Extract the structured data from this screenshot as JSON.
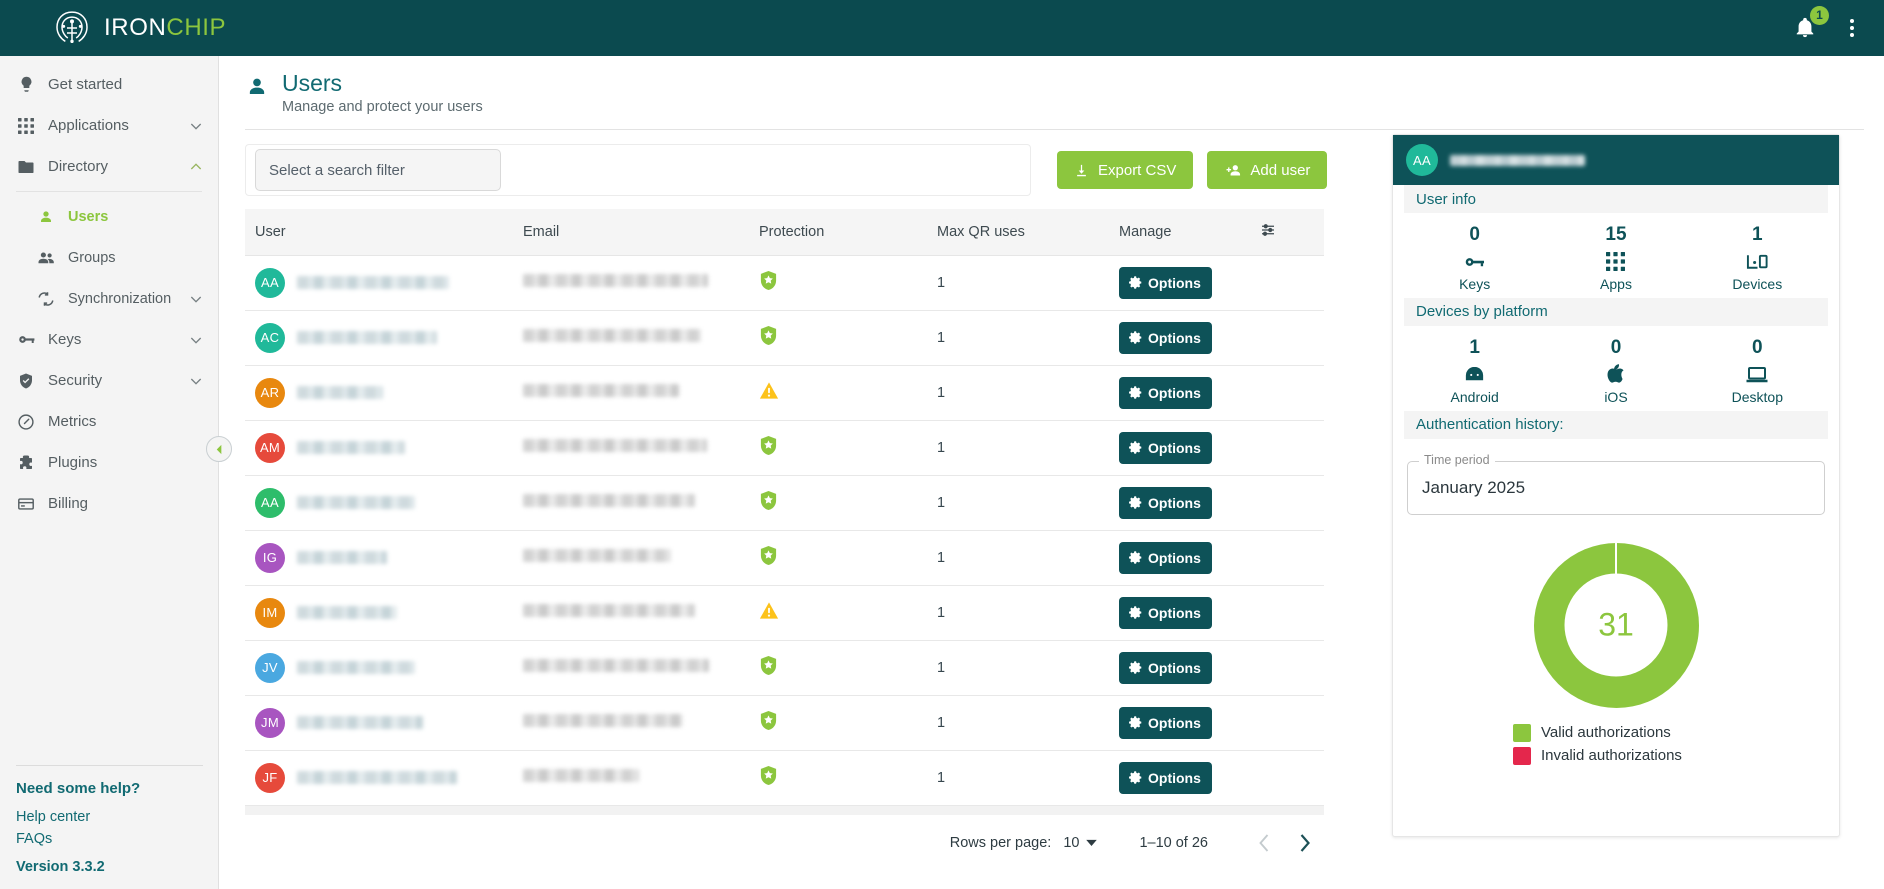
{
  "brand": {
    "name_first": "IRON",
    "name_second": "CHIP"
  },
  "topbar": {
    "notification_count": "1",
    "accent_green": "#8cc63e",
    "bg": "#0b4a4f"
  },
  "sidebar": {
    "items": [
      {
        "label": "Get started",
        "icon": "lightbulb-icon",
        "expandable": false,
        "active": false
      },
      {
        "label": "Applications",
        "icon": "grid-icon",
        "expandable": true,
        "active": false
      },
      {
        "label": "Directory",
        "icon": "folder-icon",
        "expandable": true,
        "active": false
      }
    ],
    "directory_children": [
      {
        "label": "Users",
        "icon": "person-icon",
        "active": true
      },
      {
        "label": "Groups",
        "icon": "people-icon",
        "active": false
      },
      {
        "label": "Synchronization",
        "icon": "sync-icon",
        "active": false,
        "expandable": true
      }
    ],
    "items_bottom": [
      {
        "label": "Keys",
        "icon": "key-icon",
        "expandable": true
      },
      {
        "label": "Security",
        "icon": "shield-check-icon",
        "expandable": true
      },
      {
        "label": "Metrics",
        "icon": "gauge-icon",
        "expandable": false
      },
      {
        "label": "Plugins",
        "icon": "puzzle-icon",
        "expandable": false
      },
      {
        "label": "Billing",
        "icon": "credit-card-icon",
        "expandable": false
      }
    ],
    "help": {
      "title": "Need some help?",
      "links": [
        "Help center",
        "FAQs"
      ],
      "version": "Version 3.3.2"
    }
  },
  "page": {
    "title": "Users",
    "subtitle": "Manage and protect your users"
  },
  "toolbar": {
    "filter_placeholder": "Select a search filter",
    "export_label": "Export CSV",
    "add_user_label": "Add user"
  },
  "table": {
    "columns": [
      "User",
      "Email",
      "Protection",
      "Max QR uses",
      "Manage"
    ],
    "settings_icon": "tune-icon",
    "options_label": "Options",
    "rows": [
      {
        "initials": "AA",
        "color": "#20b99a",
        "name_w": 152,
        "email_w": 185,
        "protection": "shield-star",
        "max_qr": "1"
      },
      {
        "initials": "AC",
        "color": "#20b99a",
        "name_w": 140,
        "email_w": 178,
        "protection": "shield-star",
        "max_qr": "1"
      },
      {
        "initials": "AR",
        "color": "#e8880f",
        "name_w": 86,
        "email_w": 156,
        "protection": "warning",
        "max_qr": "1"
      },
      {
        "initials": "AM",
        "color": "#e64a3b",
        "name_w": 108,
        "email_w": 184,
        "protection": "shield-star",
        "max_qr": "1"
      },
      {
        "initials": "AA",
        "color": "#2ebd6b",
        "name_w": 118,
        "email_w": 172,
        "protection": "shield-star",
        "max_qr": "1"
      },
      {
        "initials": "IG",
        "color": "#a855c0",
        "name_w": 90,
        "email_w": 148,
        "protection": "shield-star",
        "max_qr": "1"
      },
      {
        "initials": "IM",
        "color": "#e8880f",
        "name_w": 100,
        "email_w": 172,
        "protection": "warning",
        "max_qr": "1"
      },
      {
        "initials": "JV",
        "color": "#4aa8e0",
        "name_w": 118,
        "email_w": 186,
        "protection": "shield-star",
        "max_qr": "1"
      },
      {
        "initials": "JM",
        "color": "#a855c0",
        "name_w": 126,
        "email_w": 160,
        "protection": "shield-star",
        "max_qr": "1"
      },
      {
        "initials": "JF",
        "color": "#e64a3b",
        "name_w": 160,
        "email_w": 116,
        "protection": "shield-star",
        "max_qr": "1"
      }
    ]
  },
  "pagination": {
    "rows_per_page_label": "Rows per page:",
    "rows_per_page_value": "10",
    "range": "1–10 of 26",
    "prev_enabled": false,
    "next_enabled": true
  },
  "detail_panel": {
    "avatar_initials": "AA",
    "avatar_color": "#20b99a",
    "user_info_heading": "User info",
    "user_info": [
      {
        "value": "0",
        "label": "Keys",
        "icon": "key-icon"
      },
      {
        "value": "15",
        "label": "Apps",
        "icon": "grid-icon"
      },
      {
        "value": "1",
        "label": "Devices",
        "icon": "devices-icon"
      }
    ],
    "devices_heading": "Devices by platform",
    "devices": [
      {
        "value": "1",
        "label": "Android",
        "icon": "android-icon"
      },
      {
        "value": "0",
        "label": "iOS",
        "icon": "apple-icon"
      },
      {
        "value": "0",
        "label": "Desktop",
        "icon": "laptop-icon"
      }
    ],
    "auth_heading": "Authentication history:",
    "time_period_label": "Time period",
    "time_period_value": "January 2025"
  },
  "chart_data": {
    "type": "pie",
    "title": "Authentication history",
    "subtitle": "January 2025",
    "center_label": "31",
    "categories": [
      "Valid authorizations",
      "Invalid authorizations"
    ],
    "values": [
      31,
      0
    ],
    "colors": [
      "#8cc63e",
      "#e4274c"
    ],
    "legend_position": "bottom",
    "donut": true,
    "inner_radius_ratio": 0.62
  }
}
